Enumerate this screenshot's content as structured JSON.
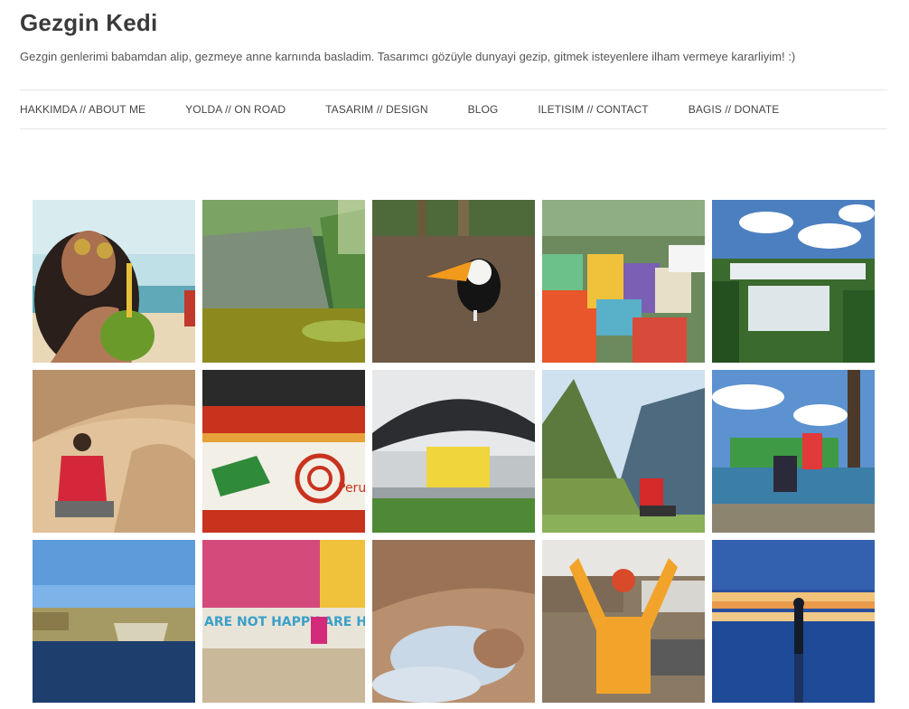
{
  "site": {
    "title": "Gezgin Kedi",
    "tagline": "Gezgin genlerimi babamdan alip, gezmeye anne karnında basladim. Tasarımcı gözüyle dunyayi gezip, gitmek isteyenlere ilham vermeye kararliyim! :)"
  },
  "nav": {
    "items": [
      {
        "label": "HAKKIMDA // ABOUT ME"
      },
      {
        "label": "YOLDA // ON ROAD"
      },
      {
        "label": "TASARIM // DESIGN"
      },
      {
        "label": "BLOG"
      },
      {
        "label": "ILETISIM // CONTACT"
      },
      {
        "label": "BAGIS // DONATE"
      }
    ]
  },
  "gallery": {
    "photos": [
      {
        "subject": "woman-coconut-beach"
      },
      {
        "subject": "cliff-lagoon"
      },
      {
        "subject": "toucan"
      },
      {
        "subject": "colorful-houses"
      },
      {
        "subject": "waterfalls"
      },
      {
        "subject": "woman-sand-dunes"
      },
      {
        "subject": "embroidered-textile",
        "text": "Peru"
      },
      {
        "subject": "modern-museum-building"
      },
      {
        "subject": "mountain-ruins"
      },
      {
        "subject": "woman-and-child-mural"
      },
      {
        "subject": "lake-reed-boats"
      },
      {
        "subject": "colorful-street-wall",
        "text": "ARE NOT HAPPY ARE HAPPIES"
      },
      {
        "subject": "sulfur-pools"
      },
      {
        "subject": "miner-celebrating"
      },
      {
        "subject": "salt-flat-sunset"
      }
    ]
  }
}
